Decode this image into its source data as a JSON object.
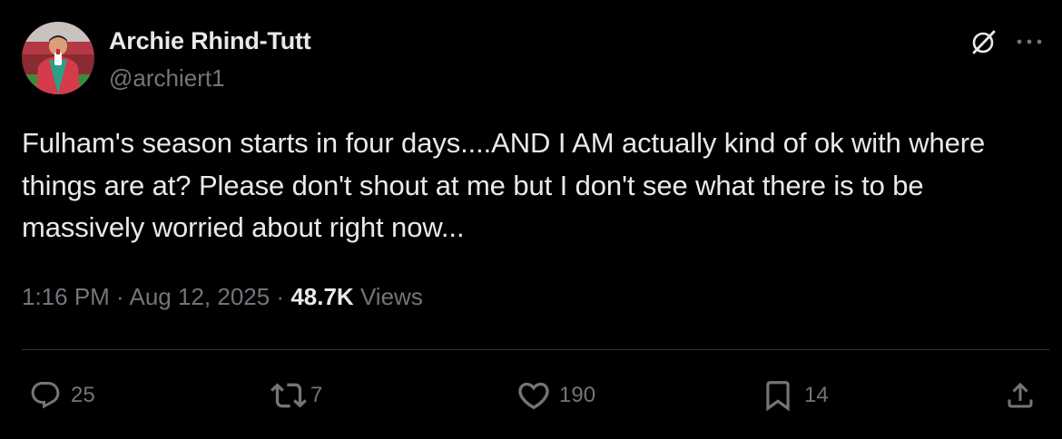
{
  "author": {
    "display_name": "Archie Rhind-Tutt",
    "handle": "@archiert1"
  },
  "tweet": {
    "text": "Fulham's season starts in four days....AND I AM actually kind of ok with where things are at? Please don't shout at me but I don't see what there is to be massively worried about right now..."
  },
  "meta": {
    "time": "1:16 PM",
    "separator": " · ",
    "date": "Aug 12, 2025",
    "views_count": "48.7K",
    "views_label": "Views"
  },
  "actions": {
    "replies": "25",
    "reposts": "7",
    "likes": "190",
    "bookmarks": "14"
  },
  "icons": {
    "grok": "grok-icon",
    "more": "more-icon",
    "reply": "reply-icon",
    "repost": "repost-icon",
    "like": "like-icon",
    "bookmark": "bookmark-icon",
    "share": "share-icon"
  },
  "colors": {
    "background": "#000000",
    "primary_text": "#e7e9ea",
    "secondary_text": "#71767b",
    "divider": "#2f3336"
  }
}
